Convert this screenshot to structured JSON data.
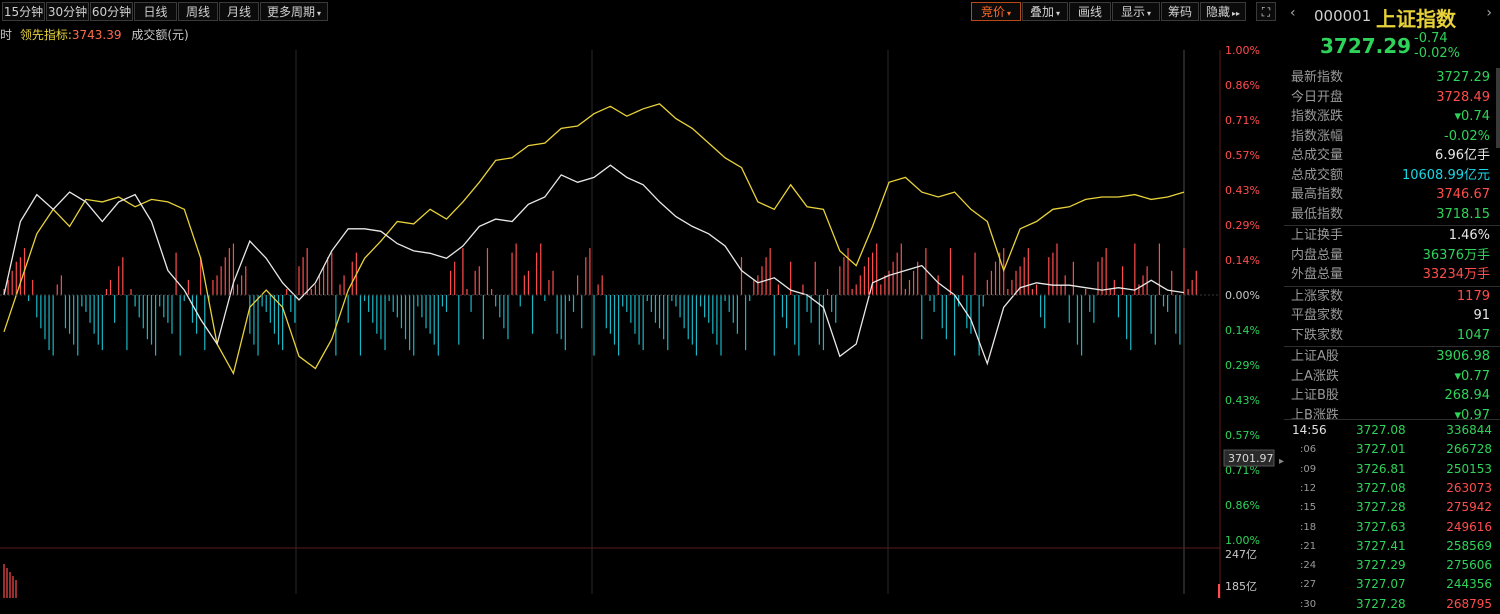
{
  "toolbar": {
    "left_buttons": [
      "15分钟",
      "30分钟",
      "60分钟",
      "日线",
      "周线",
      "月线",
      "更多周期"
    ],
    "right_buttons": [
      "竞价",
      "叠加",
      "画线",
      "显示",
      "筹码",
      "隐藏"
    ],
    "right_icon": "expand-icon"
  },
  "legend": {
    "prefix": "时",
    "indicator_label": "领先指标:",
    "indicator_value": "3743.39",
    "volume_label": "成交额(元)"
  },
  "chart_data": {
    "type": "line",
    "y_axis_labels_top": [
      "1.00%",
      "0.86%",
      "0.71%",
      "0.57%",
      "0.43%",
      "0.29%",
      "0.14%",
      "0.00%"
    ],
    "y_axis_labels_bottom": [
      "0.14%",
      "0.29%",
      "0.43%",
      "0.57%",
      "0.71%",
      "0.86%",
      "1.00%"
    ],
    "cursor_value": "3701.97",
    "volume_axis_labels": [
      "247亿",
      "185亿"
    ],
    "series": [
      {
        "color": "#e8d23a",
        "values": [
          -0.15,
          0.05,
          0.25,
          0.35,
          0.28,
          0.39,
          0.38,
          0.4,
          0.36,
          0.39,
          0.38,
          0.35,
          0.15,
          -0.2,
          -0.32,
          -0.05,
          0.02,
          -0.05,
          -0.25,
          -0.3,
          -0.18,
          0.02,
          0.15,
          0.22,
          0.3,
          0.29,
          0.35,
          0.31,
          0.38,
          0.46,
          0.55,
          0.56,
          0.61,
          0.62,
          0.68,
          0.69,
          0.74,
          0.77,
          0.73,
          0.76,
          0.78,
          0.72,
          0.68,
          0.62,
          0.56,
          0.52,
          0.38,
          0.35,
          0.45,
          0.36,
          0.35,
          0.18,
          0.12,
          0.28,
          0.46,
          0.48,
          0.42,
          0.4,
          0.42,
          0.35,
          0.3,
          0.1,
          0.27,
          0.3,
          0.35,
          0.36,
          0.39,
          0.4,
          0.4,
          0.41,
          0.39,
          0.4,
          0.42
        ]
      },
      {
        "color": "#e8e8e8",
        "values": [
          0.0,
          0.3,
          0.41,
          0.35,
          0.42,
          0.38,
          0.3,
          0.38,
          0.41,
          0.3,
          0.1,
          0.02,
          -0.1,
          -0.2,
          0.05,
          0.22,
          0.15,
          0.05,
          -0.02,
          0.05,
          0.18,
          0.27,
          0.27,
          0.26,
          0.21,
          0.18,
          0.17,
          0.15,
          0.2,
          0.28,
          0.31,
          0.3,
          0.37,
          0.4,
          0.49,
          0.46,
          0.48,
          0.53,
          0.48,
          0.45,
          0.38,
          0.32,
          0.28,
          0.25,
          0.2,
          0.1,
          0.05,
          0.07,
          0.02,
          0.0,
          -0.05,
          -0.25,
          -0.2,
          0.05,
          0.08,
          0.1,
          0.12,
          0.05,
          0.0,
          -0.1,
          -0.28,
          -0.05,
          0.03,
          0.05,
          0.04,
          0.04,
          0.03,
          0.02,
          0.03,
          0.02,
          0.06,
          0.02,
          0.01
        ]
      }
    ]
  },
  "right_panel": {
    "code": "000001",
    "name": "上证指数",
    "price": "3727.29",
    "change": "-0.74",
    "change_pct": "-0.02%",
    "stats": [
      {
        "label": "最新指数",
        "value": "3727.29",
        "color": "green"
      },
      {
        "label": "今日开盘",
        "value": "3728.49",
        "color": "red"
      },
      {
        "label": "指数涨跌",
        "value": "▾0.74",
        "color": "green"
      },
      {
        "label": "指数涨幅",
        "value": "-0.02%",
        "color": "green"
      },
      {
        "label": "总成交量",
        "value": "6.96亿手",
        "color": "white"
      },
      {
        "label": "总成交额",
        "value": "10608.99亿元",
        "color": "cyan"
      },
      {
        "label": "最高指数",
        "value": "3746.67",
        "color": "red"
      },
      {
        "label": "最低指数",
        "value": "3718.15",
        "color": "green"
      },
      {
        "label": "上证换手",
        "value": "1.46%",
        "color": "white"
      },
      {
        "label": "内盘总量",
        "value": "36376万手",
        "color": "green"
      },
      {
        "label": "外盘总量",
        "value": "33234万手",
        "color": "red"
      },
      {
        "label": "上涨家数",
        "value": "1179",
        "color": "red"
      },
      {
        "label": "平盘家数",
        "value": "91",
        "color": "white"
      },
      {
        "label": "下跌家数",
        "value": "1047",
        "color": "green"
      },
      {
        "label": "上证A股",
        "value": "3906.98",
        "color": "green"
      },
      {
        "label": "上A涨跌",
        "value": "▾0.77",
        "color": "green"
      },
      {
        "label": "上证B股",
        "value": "268.94",
        "color": "green"
      },
      {
        "label": "上B涨跌",
        "value": "▾0.97",
        "color": "green"
      }
    ],
    "ticks": [
      {
        "time": "14:56",
        "price": "3727.08",
        "vol": "336844",
        "vol_color": "green"
      },
      {
        "time": ":06",
        "price": "3727.01",
        "vol": "266728",
        "vol_color": "green"
      },
      {
        "time": ":09",
        "price": "3726.81",
        "vol": "250153",
        "vol_color": "green"
      },
      {
        "time": ":12",
        "price": "3727.08",
        "vol": "263073",
        "vol_color": "red"
      },
      {
        "time": ":15",
        "price": "3727.28",
        "vol": "275942",
        "vol_color": "red"
      },
      {
        "time": ":18",
        "price": "3727.63",
        "vol": "249616",
        "vol_color": "red"
      },
      {
        "time": ":21",
        "price": "3727.41",
        "vol": "258569",
        "vol_color": "green"
      },
      {
        "time": ":24",
        "price": "3727.29",
        "vol": "275606",
        "vol_color": "green"
      },
      {
        "time": ":27",
        "price": "3727.07",
        "vol": "244356",
        "vol_color": "green"
      },
      {
        "time": ":30",
        "price": "3727.28",
        "vol": "268795",
        "vol_color": "red"
      }
    ]
  }
}
